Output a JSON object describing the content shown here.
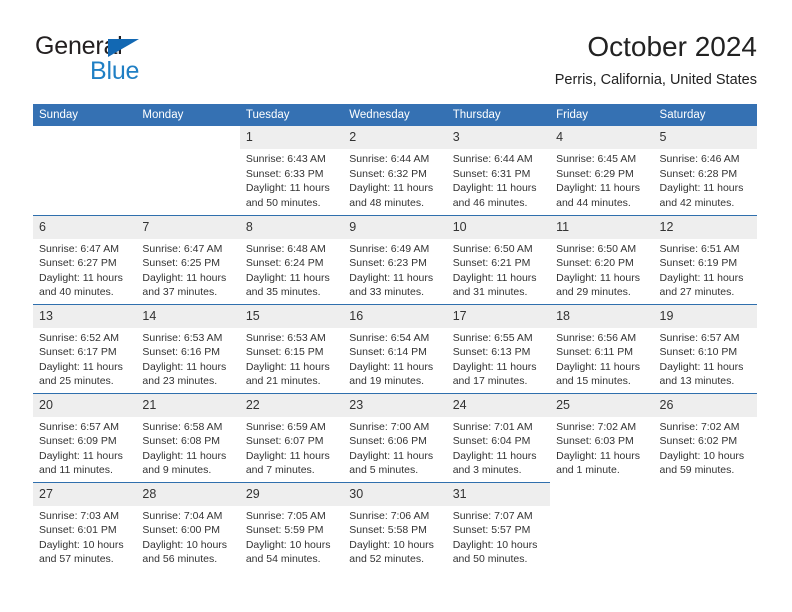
{
  "brand": {
    "name_top": "General",
    "name_bottom": "Blue",
    "color_primary": "#1268b3",
    "color_secondary": "#1f7fc4",
    "icon": "triangle-logo-icon"
  },
  "header": {
    "title": "October 2024",
    "subtitle": "Perris, California, United States"
  },
  "theme": {
    "header_blue": "#3571b3",
    "row_divider": "#2f6fad",
    "daynum_band": "#eeeeee",
    "text": "#333333"
  },
  "weekday_headers": [
    "Sunday",
    "Monday",
    "Tuesday",
    "Wednesday",
    "Thursday",
    "Friday",
    "Saturday"
  ],
  "labels": {
    "sunrise": "Sunrise:",
    "sunset": "Sunset:",
    "daylight": "Daylight:"
  },
  "weeks": [
    [
      {
        "day": "",
        "empty": true
      },
      {
        "day": "",
        "empty": true
      },
      {
        "day": "1",
        "sunrise": "Sunrise: 6:43 AM",
        "sunset": "Sunset: 6:33 PM",
        "daylight": "Daylight: 11 hours and 50 minutes."
      },
      {
        "day": "2",
        "sunrise": "Sunrise: 6:44 AM",
        "sunset": "Sunset: 6:32 PM",
        "daylight": "Daylight: 11 hours and 48 minutes."
      },
      {
        "day": "3",
        "sunrise": "Sunrise: 6:44 AM",
        "sunset": "Sunset: 6:31 PM",
        "daylight": "Daylight: 11 hours and 46 minutes."
      },
      {
        "day": "4",
        "sunrise": "Sunrise: 6:45 AM",
        "sunset": "Sunset: 6:29 PM",
        "daylight": "Daylight: 11 hours and 44 minutes."
      },
      {
        "day": "5",
        "sunrise": "Sunrise: 6:46 AM",
        "sunset": "Sunset: 6:28 PM",
        "daylight": "Daylight: 11 hours and 42 minutes."
      }
    ],
    [
      {
        "day": "6",
        "sunrise": "Sunrise: 6:47 AM",
        "sunset": "Sunset: 6:27 PM",
        "daylight": "Daylight: 11 hours and 40 minutes."
      },
      {
        "day": "7",
        "sunrise": "Sunrise: 6:47 AM",
        "sunset": "Sunset: 6:25 PM",
        "daylight": "Daylight: 11 hours and 37 minutes."
      },
      {
        "day": "8",
        "sunrise": "Sunrise: 6:48 AM",
        "sunset": "Sunset: 6:24 PM",
        "daylight": "Daylight: 11 hours and 35 minutes."
      },
      {
        "day": "9",
        "sunrise": "Sunrise: 6:49 AM",
        "sunset": "Sunset: 6:23 PM",
        "daylight": "Daylight: 11 hours and 33 minutes."
      },
      {
        "day": "10",
        "sunrise": "Sunrise: 6:50 AM",
        "sunset": "Sunset: 6:21 PM",
        "daylight": "Daylight: 11 hours and 31 minutes."
      },
      {
        "day": "11",
        "sunrise": "Sunrise: 6:50 AM",
        "sunset": "Sunset: 6:20 PM",
        "daylight": "Daylight: 11 hours and 29 minutes."
      },
      {
        "day": "12",
        "sunrise": "Sunrise: 6:51 AM",
        "sunset": "Sunset: 6:19 PM",
        "daylight": "Daylight: 11 hours and 27 minutes."
      }
    ],
    [
      {
        "day": "13",
        "sunrise": "Sunrise: 6:52 AM",
        "sunset": "Sunset: 6:17 PM",
        "daylight": "Daylight: 11 hours and 25 minutes."
      },
      {
        "day": "14",
        "sunrise": "Sunrise: 6:53 AM",
        "sunset": "Sunset: 6:16 PM",
        "daylight": "Daylight: 11 hours and 23 minutes."
      },
      {
        "day": "15",
        "sunrise": "Sunrise: 6:53 AM",
        "sunset": "Sunset: 6:15 PM",
        "daylight": "Daylight: 11 hours and 21 minutes."
      },
      {
        "day": "16",
        "sunrise": "Sunrise: 6:54 AM",
        "sunset": "Sunset: 6:14 PM",
        "daylight": "Daylight: 11 hours and 19 minutes."
      },
      {
        "day": "17",
        "sunrise": "Sunrise: 6:55 AM",
        "sunset": "Sunset: 6:13 PM",
        "daylight": "Daylight: 11 hours and 17 minutes."
      },
      {
        "day": "18",
        "sunrise": "Sunrise: 6:56 AM",
        "sunset": "Sunset: 6:11 PM",
        "daylight": "Daylight: 11 hours and 15 minutes."
      },
      {
        "day": "19",
        "sunrise": "Sunrise: 6:57 AM",
        "sunset": "Sunset: 6:10 PM",
        "daylight": "Daylight: 11 hours and 13 minutes."
      }
    ],
    [
      {
        "day": "20",
        "sunrise": "Sunrise: 6:57 AM",
        "sunset": "Sunset: 6:09 PM",
        "daylight": "Daylight: 11 hours and 11 minutes."
      },
      {
        "day": "21",
        "sunrise": "Sunrise: 6:58 AM",
        "sunset": "Sunset: 6:08 PM",
        "daylight": "Daylight: 11 hours and 9 minutes."
      },
      {
        "day": "22",
        "sunrise": "Sunrise: 6:59 AM",
        "sunset": "Sunset: 6:07 PM",
        "daylight": "Daylight: 11 hours and 7 minutes."
      },
      {
        "day": "23",
        "sunrise": "Sunrise: 7:00 AM",
        "sunset": "Sunset: 6:06 PM",
        "daylight": "Daylight: 11 hours and 5 minutes."
      },
      {
        "day": "24",
        "sunrise": "Sunrise: 7:01 AM",
        "sunset": "Sunset: 6:04 PM",
        "daylight": "Daylight: 11 hours and 3 minutes."
      },
      {
        "day": "25",
        "sunrise": "Sunrise: 7:02 AM",
        "sunset": "Sunset: 6:03 PM",
        "daylight": "Daylight: 11 hours and 1 minute."
      },
      {
        "day": "26",
        "sunrise": "Sunrise: 7:02 AM",
        "sunset": "Sunset: 6:02 PM",
        "daylight": "Daylight: 10 hours and 59 minutes."
      }
    ],
    [
      {
        "day": "27",
        "sunrise": "Sunrise: 7:03 AM",
        "sunset": "Sunset: 6:01 PM",
        "daylight": "Daylight: 10 hours and 57 minutes."
      },
      {
        "day": "28",
        "sunrise": "Sunrise: 7:04 AM",
        "sunset": "Sunset: 6:00 PM",
        "daylight": "Daylight: 10 hours and 56 minutes."
      },
      {
        "day": "29",
        "sunrise": "Sunrise: 7:05 AM",
        "sunset": "Sunset: 5:59 PM",
        "daylight": "Daylight: 10 hours and 54 minutes."
      },
      {
        "day": "30",
        "sunrise": "Sunrise: 7:06 AM",
        "sunset": "Sunset: 5:58 PM",
        "daylight": "Daylight: 10 hours and 52 minutes."
      },
      {
        "day": "31",
        "sunrise": "Sunrise: 7:07 AM",
        "sunset": "Sunset: 5:57 PM",
        "daylight": "Daylight: 10 hours and 50 minutes."
      },
      {
        "day": "",
        "empty": true
      },
      {
        "day": "",
        "empty": true
      }
    ]
  ]
}
